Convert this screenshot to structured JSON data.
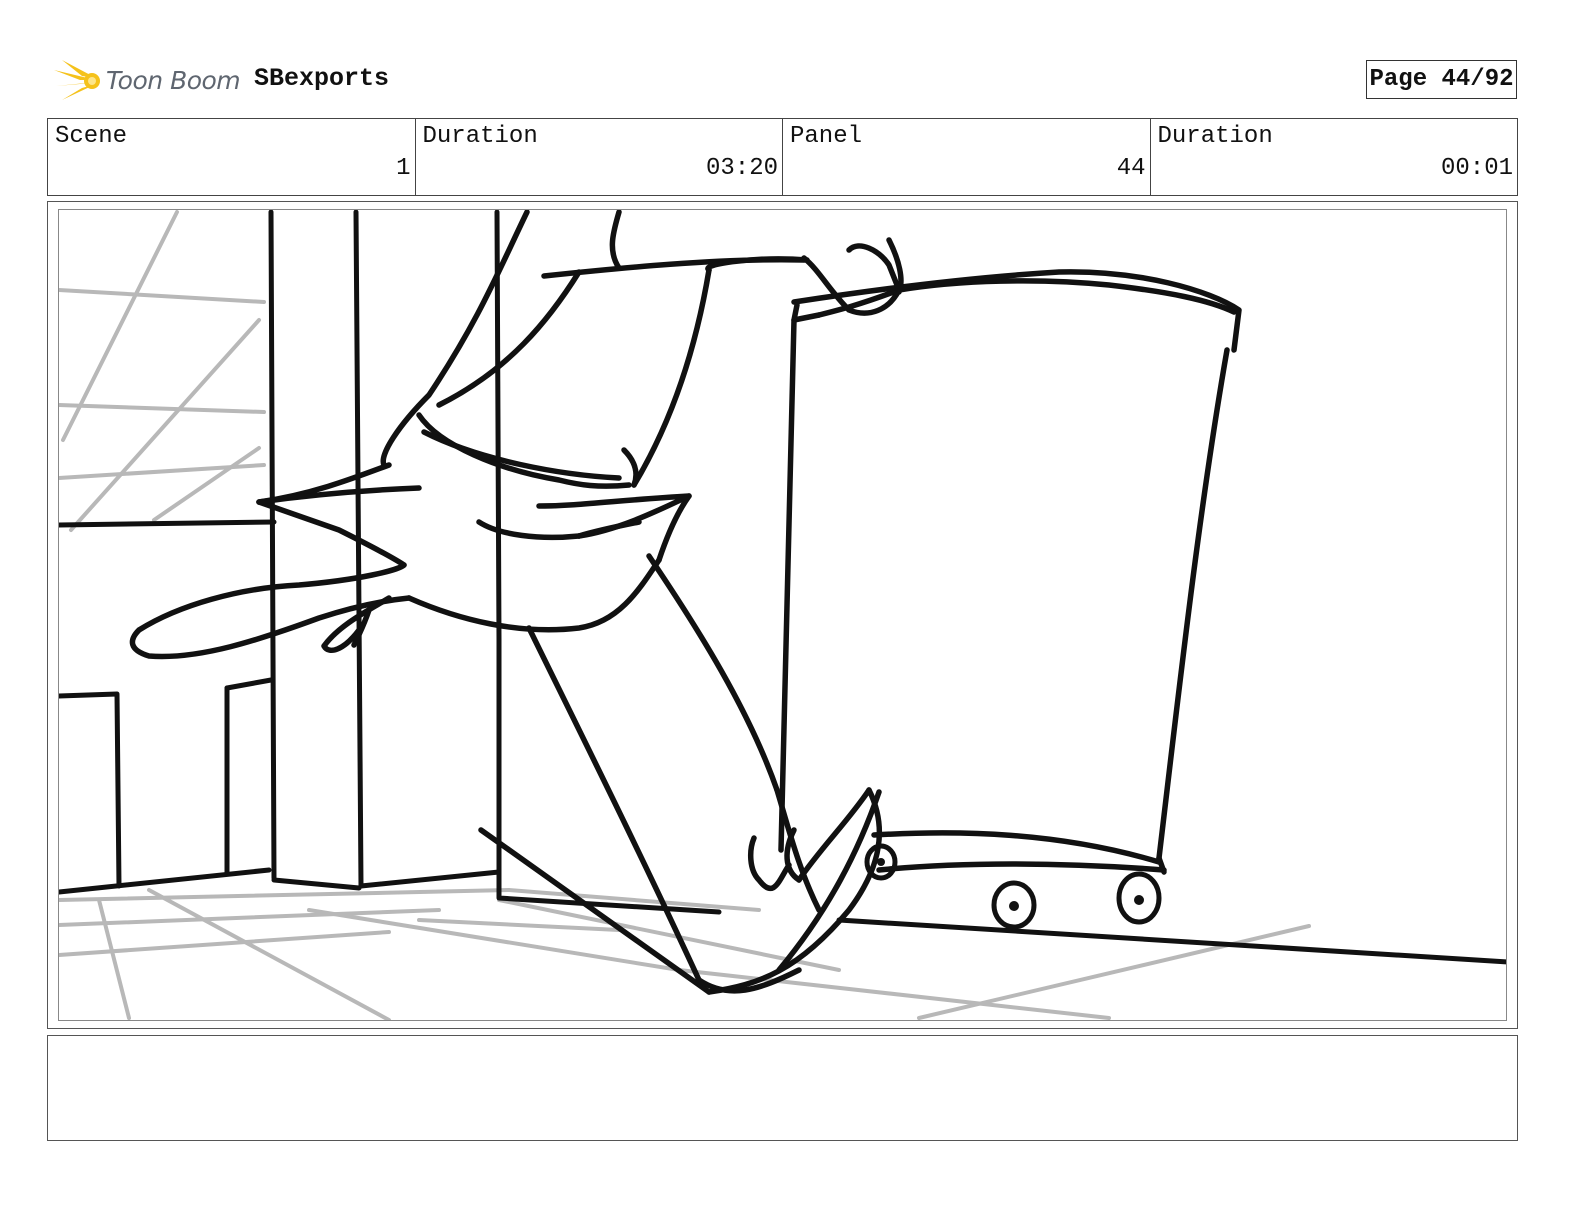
{
  "header": {
    "logo_text": "Toon Boom",
    "project_name": "SBexports",
    "page_label": "Page 44/92"
  },
  "info": {
    "scene_label": "Scene",
    "scene_value": "1",
    "scene_duration_label": "Duration",
    "scene_duration_value": "03:20",
    "panel_label": "Panel",
    "panel_value": "44",
    "panel_duration_label": "Duration",
    "panel_duration_value": "00:01"
  },
  "notes": {
    "text": ""
  },
  "colors": {
    "logo_star": "#f5c21b",
    "logo_text": "#5f6670",
    "sketch_line": "#111111",
    "sketch_guide": "#b8b8b8",
    "border": "#444444"
  }
}
